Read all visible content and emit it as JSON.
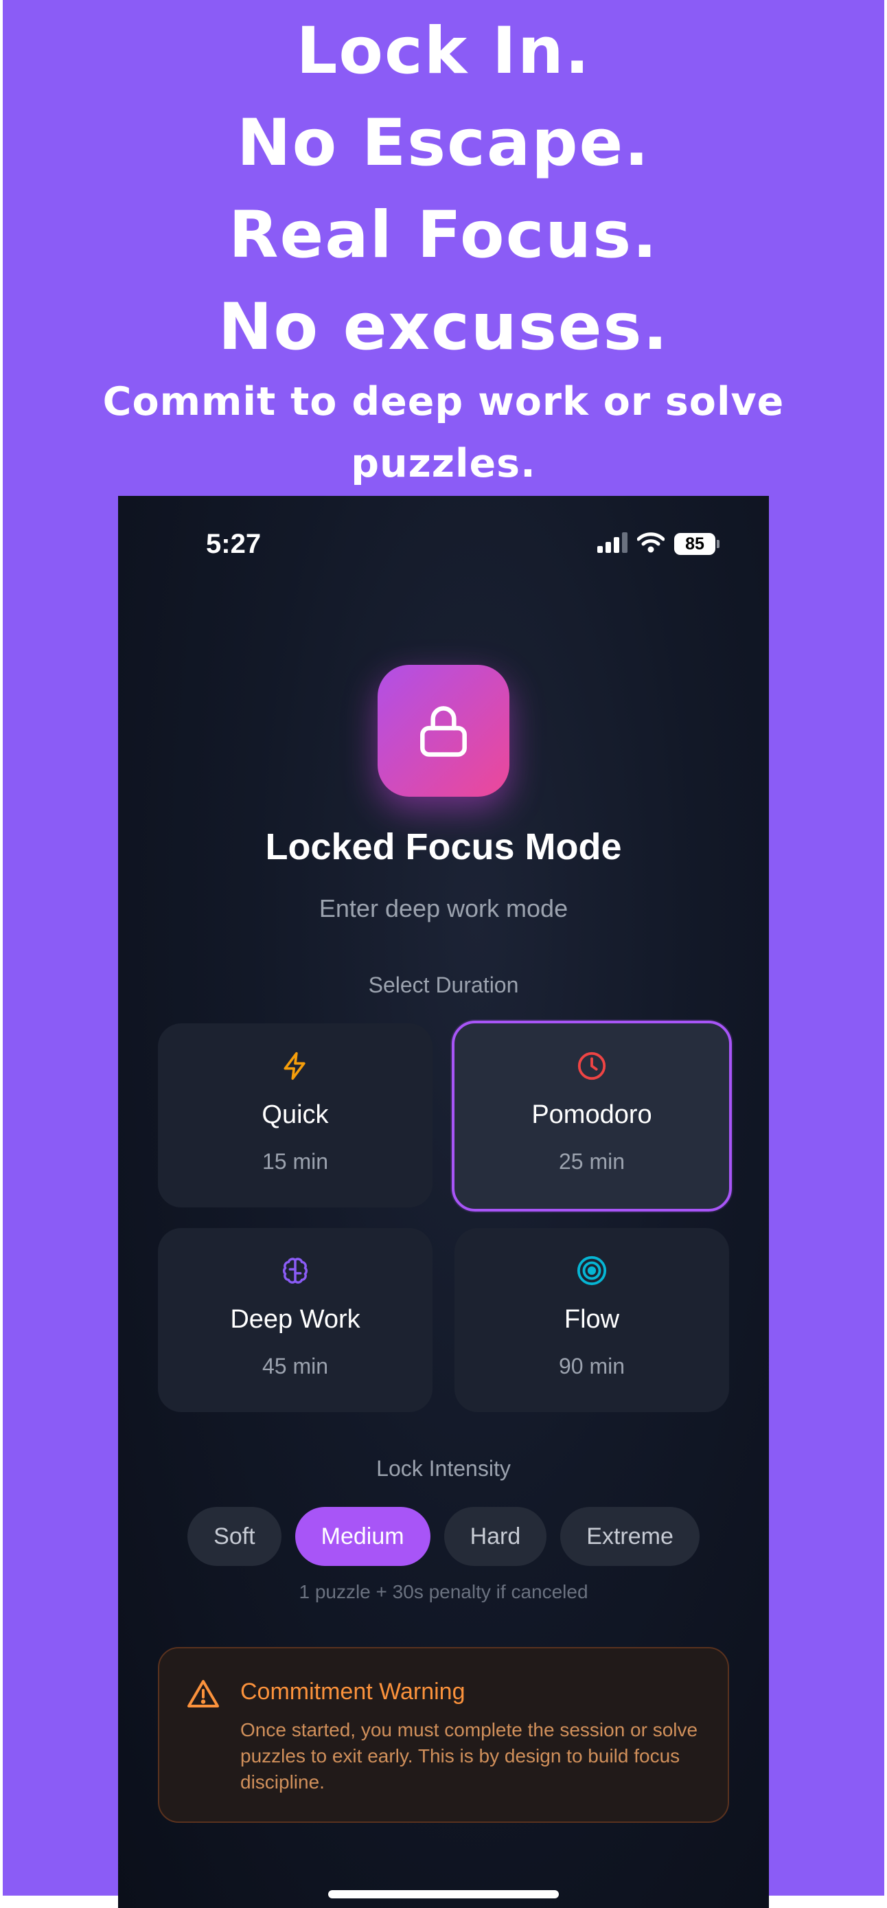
{
  "promo": {
    "headline_lines": [
      "Lock In.",
      "No Escape.",
      "Real Focus.",
      "No excuses."
    ],
    "subheadline": "Commit to deep work or solve puzzles."
  },
  "status_bar": {
    "time": "5:27",
    "battery": "85",
    "icons": [
      "cellular-signal-icon",
      "wifi-icon",
      "battery-icon"
    ]
  },
  "header": {
    "icon": "lock-icon",
    "title": "Locked Focus Mode",
    "subtitle": "Enter deep work mode"
  },
  "duration": {
    "label": "Select Duration",
    "options": [
      {
        "name": "Quick",
        "duration": "15 min",
        "icon": "lightning-icon",
        "color": "#f59e0b",
        "selected": false
      },
      {
        "name": "Pomodoro",
        "duration": "25 min",
        "icon": "clock-icon",
        "color": "#ef4444",
        "selected": true
      },
      {
        "name": "Deep Work",
        "duration": "45 min",
        "icon": "brain-icon",
        "color": "#8b5cf6",
        "selected": false
      },
      {
        "name": "Flow",
        "duration": "90 min",
        "icon": "target-icon",
        "color": "#06b6d4",
        "selected": false
      }
    ]
  },
  "intensity": {
    "label": "Lock Intensity",
    "options": [
      "Soft",
      "Medium",
      "Hard",
      "Extreme"
    ],
    "selected": "Medium",
    "note": "1 puzzle + 30s penalty if canceled"
  },
  "warning": {
    "icon": "warning-triangle-icon",
    "title": "Commitment Warning",
    "body": "Once started, you must complete the session or solve puzzles to exit early. This is by design to build focus discipline."
  },
  "colors": {
    "promo_background": "#8b5cf6",
    "accent": "#a855f7",
    "warning": "#fb923c"
  }
}
